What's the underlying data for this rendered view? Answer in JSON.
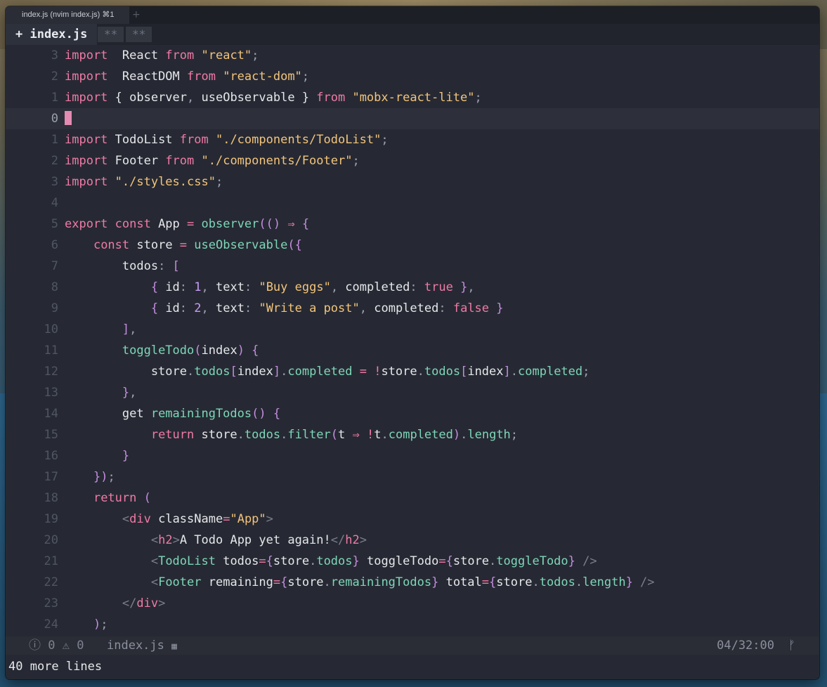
{
  "window": {
    "title": "index.js (nvim index.js) ⌘1",
    "new_tab_glyph": "+"
  },
  "bufferline": {
    "active": "+ index.js",
    "inactive": [
      "**",
      "**"
    ]
  },
  "editor": {
    "lines": [
      {
        "n": "3",
        "tokens": [
          [
            "k",
            "import"
          ],
          [
            "",
            "  React "
          ],
          [
            "k",
            "from"
          ],
          [
            "s",
            " \"react\""
          ],
          [
            "p",
            ";"
          ]
        ]
      },
      {
        "n": "2",
        "tokens": [
          [
            "k",
            "import"
          ],
          [
            "",
            "  ReactDOM "
          ],
          [
            "k",
            "from"
          ],
          [
            "s",
            " \"react-dom\""
          ],
          [
            "p",
            ";"
          ]
        ]
      },
      {
        "n": "1",
        "tokens": [
          [
            "k",
            "import"
          ],
          [
            "",
            " { observer"
          ],
          [
            "p",
            ","
          ],
          [
            "",
            " useObservable } "
          ],
          [
            "k",
            "from"
          ],
          [
            "s",
            " \"mobx-react-lite\""
          ],
          [
            "p",
            ";"
          ]
        ]
      },
      {
        "n": "0",
        "current": true,
        "cursor": true,
        "tokens": []
      },
      {
        "n": "1",
        "tokens": [
          [
            "k",
            "import"
          ],
          [
            "",
            " TodoList "
          ],
          [
            "k",
            "from"
          ],
          [
            "s",
            " \"./components/TodoList\""
          ],
          [
            "p",
            ";"
          ]
        ]
      },
      {
        "n": "2",
        "tokens": [
          [
            "k",
            "import"
          ],
          [
            "",
            " Footer "
          ],
          [
            "k",
            "from"
          ],
          [
            "s",
            " \"./components/Footer\""
          ],
          [
            "p",
            ";"
          ]
        ]
      },
      {
        "n": "3",
        "tokens": [
          [
            "k",
            "import"
          ],
          [
            "s",
            " \"./styles.css\""
          ],
          [
            "p",
            ";"
          ]
        ]
      },
      {
        "n": "4",
        "tokens": []
      },
      {
        "n": "5",
        "tokens": [
          [
            "k",
            "export const"
          ],
          [
            "",
            " App "
          ],
          [
            "k",
            "="
          ],
          [
            "f",
            " observer"
          ],
          [
            "b",
            "(() "
          ],
          [
            "k",
            "⇒"
          ],
          [
            "b",
            " {"
          ]
        ]
      },
      {
        "n": "6",
        "tokens": [
          [
            "",
            "    "
          ],
          [
            "k",
            "const"
          ],
          [
            "",
            " store "
          ],
          [
            "k",
            "="
          ],
          [
            "f",
            " useObservable"
          ],
          [
            "b",
            "({"
          ]
        ]
      },
      {
        "n": "7",
        "tokens": [
          [
            "",
            "        todos"
          ],
          [
            "p",
            ":"
          ],
          [
            "b",
            " ["
          ]
        ]
      },
      {
        "n": "8",
        "tokens": [
          [
            "",
            "            "
          ],
          [
            "b",
            "{"
          ],
          [
            "",
            " id"
          ],
          [
            "p",
            ":"
          ],
          [
            "n",
            " 1"
          ],
          [
            "p",
            ","
          ],
          [
            "",
            " text"
          ],
          [
            "p",
            ":"
          ],
          [
            "s",
            " \"Buy eggs\""
          ],
          [
            "p",
            ","
          ],
          [
            "",
            " completed"
          ],
          [
            "p",
            ":"
          ],
          [
            "k",
            " true"
          ],
          [
            "b",
            " }"
          ],
          [
            "p",
            ","
          ]
        ]
      },
      {
        "n": "9",
        "tokens": [
          [
            "",
            "            "
          ],
          [
            "b",
            "{"
          ],
          [
            "",
            " id"
          ],
          [
            "p",
            ":"
          ],
          [
            "n",
            " 2"
          ],
          [
            "p",
            ","
          ],
          [
            "",
            " text"
          ],
          [
            "p",
            ":"
          ],
          [
            "s",
            " \"Write a post\""
          ],
          [
            "p",
            ","
          ],
          [
            "",
            " completed"
          ],
          [
            "p",
            ":"
          ],
          [
            "k",
            " false"
          ],
          [
            "b",
            " }"
          ]
        ]
      },
      {
        "n": "10",
        "tokens": [
          [
            "",
            "        "
          ],
          [
            "b",
            "]"
          ],
          [
            "p",
            ","
          ]
        ]
      },
      {
        "n": "11",
        "tokens": [
          [
            "",
            "        "
          ],
          [
            "f",
            "toggleTodo"
          ],
          [
            "b",
            "("
          ],
          [
            "",
            "index"
          ],
          [
            "b",
            ")"
          ],
          [
            "b",
            " {"
          ]
        ]
      },
      {
        "n": "12",
        "tokens": [
          [
            "",
            "            store"
          ],
          [
            "p",
            "."
          ],
          [
            "f",
            "todos"
          ],
          [
            "b",
            "["
          ],
          [
            "",
            "index"
          ],
          [
            "b",
            "]"
          ],
          [
            "p",
            "."
          ],
          [
            "f",
            "completed"
          ],
          [
            "k",
            " = !"
          ],
          [
            "",
            "store"
          ],
          [
            "p",
            "."
          ],
          [
            "f",
            "todos"
          ],
          [
            "b",
            "["
          ],
          [
            "",
            "index"
          ],
          [
            "b",
            "]"
          ],
          [
            "p",
            "."
          ],
          [
            "f",
            "completed"
          ],
          [
            "p",
            ";"
          ]
        ]
      },
      {
        "n": "13",
        "tokens": [
          [
            "",
            "        "
          ],
          [
            "b",
            "}"
          ],
          [
            "p",
            ","
          ]
        ]
      },
      {
        "n": "14",
        "tokens": [
          [
            "",
            "        get "
          ],
          [
            "f",
            "remainingTodos"
          ],
          [
            "b",
            "()"
          ],
          [
            "b",
            " {"
          ]
        ]
      },
      {
        "n": "15",
        "tokens": [
          [
            "",
            "            "
          ],
          [
            "k",
            "return"
          ],
          [
            "",
            " store"
          ],
          [
            "p",
            "."
          ],
          [
            "f",
            "todos"
          ],
          [
            "p",
            "."
          ],
          [
            "f",
            "filter"
          ],
          [
            "b",
            "("
          ],
          [
            "",
            "t "
          ],
          [
            "k",
            "⇒"
          ],
          [
            "k",
            " !"
          ],
          [
            "",
            "t"
          ],
          [
            "p",
            "."
          ],
          [
            "f",
            "completed"
          ],
          [
            "b",
            ")"
          ],
          [
            "p",
            "."
          ],
          [
            "f",
            "length"
          ],
          [
            "p",
            ";"
          ]
        ]
      },
      {
        "n": "16",
        "tokens": [
          [
            "",
            "        "
          ],
          [
            "b",
            "}"
          ]
        ]
      },
      {
        "n": "17",
        "tokens": [
          [
            "",
            "    "
          ],
          [
            "b",
            "})"
          ],
          [
            "p",
            ";"
          ]
        ]
      },
      {
        "n": "18",
        "tokens": [
          [
            "",
            "    "
          ],
          [
            "k",
            "return"
          ],
          [
            "b",
            " ("
          ]
        ]
      },
      {
        "n": "19",
        "tokens": [
          [
            "",
            "        "
          ],
          [
            "t",
            "<"
          ],
          [
            "k",
            "div"
          ],
          [
            "",
            " className"
          ],
          [
            "k",
            "="
          ],
          [
            "s",
            "\"App\""
          ],
          [
            "t",
            ">"
          ]
        ]
      },
      {
        "n": "20",
        "tokens": [
          [
            "",
            "            "
          ],
          [
            "t",
            "<"
          ],
          [
            "k",
            "h2"
          ],
          [
            "t",
            ">"
          ],
          [
            "",
            "A Todo App yet again!"
          ],
          [
            "t",
            "</"
          ],
          [
            "k",
            "h2"
          ],
          [
            "t",
            ">"
          ]
        ]
      },
      {
        "n": "21",
        "tokens": [
          [
            "",
            "            "
          ],
          [
            "t",
            "<"
          ],
          [
            "f",
            "TodoList"
          ],
          [
            "",
            " todos"
          ],
          [
            "k",
            "="
          ],
          [
            "b",
            "{"
          ],
          [
            "",
            "store"
          ],
          [
            "p",
            "."
          ],
          [
            "f",
            "todos"
          ],
          [
            "b",
            "}"
          ],
          [
            "",
            " toggleTodo"
          ],
          [
            "k",
            "="
          ],
          [
            "b",
            "{"
          ],
          [
            "",
            "store"
          ],
          [
            "p",
            "."
          ],
          [
            "f",
            "toggleTodo"
          ],
          [
            "b",
            "}"
          ],
          [
            "t",
            " />"
          ]
        ]
      },
      {
        "n": "22",
        "tokens": [
          [
            "",
            "            "
          ],
          [
            "t",
            "<"
          ],
          [
            "f",
            "Footer"
          ],
          [
            "",
            " remaining"
          ],
          [
            "k",
            "="
          ],
          [
            "b",
            "{"
          ],
          [
            "",
            "store"
          ],
          [
            "p",
            "."
          ],
          [
            "f",
            "remainingTodos"
          ],
          [
            "b",
            "}"
          ],
          [
            "",
            " total"
          ],
          [
            "k",
            "="
          ],
          [
            "b",
            "{"
          ],
          [
            "",
            "store"
          ],
          [
            "p",
            "."
          ],
          [
            "f",
            "todos"
          ],
          [
            "p",
            "."
          ],
          [
            "f",
            "length"
          ],
          [
            "b",
            "}"
          ],
          [
            "t",
            " />"
          ]
        ]
      },
      {
        "n": "23",
        "tokens": [
          [
            "",
            "        "
          ],
          [
            "t",
            "</"
          ],
          [
            "k",
            "div"
          ],
          [
            "t",
            ">"
          ]
        ]
      },
      {
        "n": "24",
        "tokens": [
          [
            "",
            "    "
          ],
          [
            "b",
            ")"
          ],
          [
            "p",
            ";"
          ]
        ]
      }
    ]
  },
  "statusline": {
    "errors": "0",
    "warnings": "0",
    "filename": "index.js",
    "time": "04/32:00",
    "branch_glyph": "ᚠ"
  },
  "cmdline": "40 more lines"
}
